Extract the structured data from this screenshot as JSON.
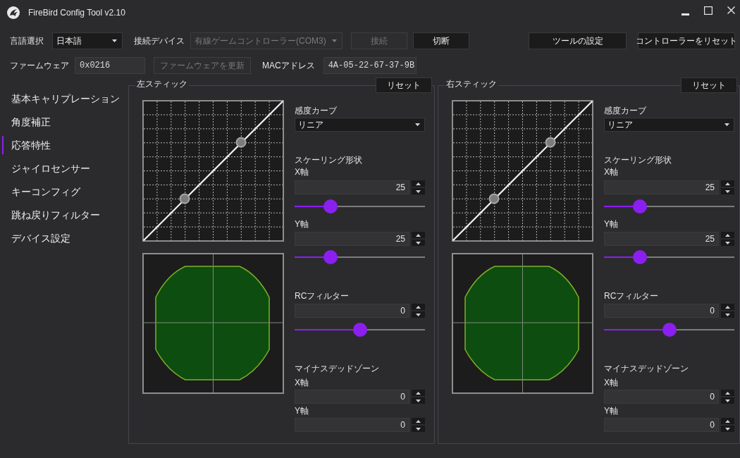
{
  "window": {
    "title": "FireBird Config Tool v2.10"
  },
  "connection_bar": {
    "language_label": "言語選択",
    "language": {
      "value": "日本語",
      "disabled": false
    },
    "device_label": "接続デバイス",
    "device": {
      "value": "有線ゲームコントローラー(COM3)",
      "disabled": true
    },
    "buttons": [
      {
        "label": "接続",
        "disabled": true
      },
      {
        "label": "切断",
        "disabled": false
      }
    ],
    "tool_buttons": [
      "ツールの設定",
      "コントローラーをリセット"
    ]
  },
  "firmware_bar": {
    "firmware_label": "ファームウェア",
    "firmware_version": "0x0216",
    "update_button": {
      "label": "ファームウェアを更新",
      "disabled": true
    },
    "mac_label": "MACアドレス",
    "mac_address": "4A-05-22-67-37-9B"
  },
  "sidebar": {
    "items": [
      {
        "label": "基本キャリプレーション",
        "selected": false
      },
      {
        "label": "角度補正",
        "selected": false
      },
      {
        "label": "応答特性",
        "selected": true
      },
      {
        "label": "ジャイロセンサー",
        "selected": false
      },
      {
        "label": "キーコンフィグ",
        "selected": false
      },
      {
        "label": "跳ね戻りフィルター",
        "selected": false
      },
      {
        "label": "デバイス設定",
        "selected": false
      }
    ]
  },
  "sticks": [
    {
      "title": "左スティック",
      "reset_button": "リセット",
      "sensitivity_curve": {
        "label": "感度カーブ",
        "value": "リニア"
      },
      "scaling_shape": {
        "label": "スケーリング形状",
        "axes": [
          {
            "label": "X軸",
            "value": "25",
            "level": 0.25
          },
          {
            "label": "Y軸",
            "value": "25",
            "level": 0.25
          }
        ]
      },
      "rc_filter": {
        "label": "RCフィルター",
        "value": "0",
        "level": 0.5
      },
      "negative_deadzone": {
        "label": "マイナスデッドゾーン",
        "axes": [
          {
            "label": "X軸",
            "value": "0"
          },
          {
            "label": "Y軸",
            "value": "0"
          }
        ]
      }
    },
    {
      "title": "右スティック",
      "reset_button": "リセット",
      "sensitivity_curve": {
        "label": "感度カーブ",
        "value": "リニア"
      },
      "scaling_shape": {
        "label": "スケーリング形状",
        "axes": [
          {
            "label": "X軸",
            "value": "25",
            "level": 0.25
          },
          {
            "label": "Y軸",
            "value": "25",
            "level": 0.25
          }
        ]
      },
      "rc_filter": {
        "label": "RCフィルター",
        "value": "0",
        "level": 0.5
      },
      "negative_deadzone": {
        "label": "マイナスデッドゾーン",
        "axes": [
          {
            "label": "X軸",
            "value": "0"
          },
          {
            "label": "Y軸",
            "value": "0"
          }
        ]
      }
    }
  ]
}
